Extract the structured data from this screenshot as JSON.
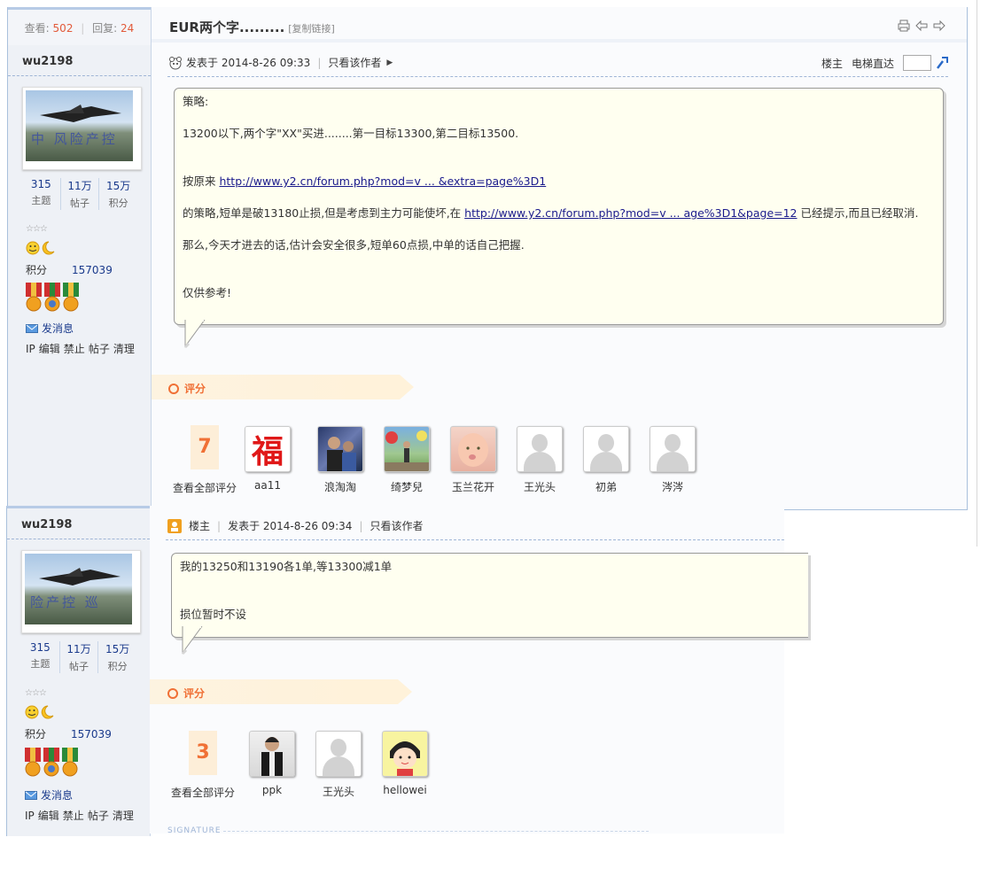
{
  "thread": {
    "views_label": "查看:",
    "views": "502",
    "replies_label": "回复:",
    "replies": "24",
    "title": "EUR两个字.........",
    "copy_link": "[复制链接]"
  },
  "floor_tools": {
    "owner_label": "楼主",
    "elevator_label": "电梯直达"
  },
  "posts": [
    {
      "author": "wu2198",
      "avatar_text": "中 风险产控",
      "counts": [
        {
          "value": "315",
          "label": "主题"
        },
        {
          "value": "11万",
          "label": "帖子"
        },
        {
          "value": "15万",
          "label": "积分"
        }
      ],
      "stars": "☆☆☆",
      "score_label": "积分",
      "score": "157039",
      "send_msg": "发消息",
      "admin_tools": [
        "IP",
        "编辑",
        "禁止",
        "帖子",
        "清理"
      ],
      "posted": "发表于 2014-8-26 09:33",
      "only_author": "只看该作者",
      "content": {
        "l1": "策略:",
        "l2": "13200以下,两个字\"XX\"买进........第一目标13300,第二目标13500.",
        "l3_prefix": "按原来 ",
        "l3_link": "http://www.y2.cn/forum.php?mod=v ... &extra=page%3D1",
        "l4_prefix": "的策略,短单是破13180止损,但是考虑到主力可能使坏,在 ",
        "l4_link": "http://www.y2.cn/forum.php?mod=v ... age%3D1&page=12",
        "l4_suffix": "   已经提示,而且已经取消.",
        "l5": "那么,今天才进去的话,估计会安全很多,短单60点损,中单的话自己把握.",
        "l6": "仅供参考!"
      },
      "rating_label": "评分",
      "rating_count": "7",
      "view_all_ratings": "查看全部评分",
      "raters": [
        "aa11",
        "浪淘淘",
        "绮梦兒",
        "玉兰花开",
        "王光头",
        "初弟",
        "涔涔"
      ]
    },
    {
      "author": "wu2198",
      "avatar_text": "险产控 巡",
      "counts": [
        {
          "value": "315",
          "label": "主题"
        },
        {
          "value": "11万",
          "label": "帖子"
        },
        {
          "value": "15万",
          "label": "积分"
        }
      ],
      "stars": "☆☆☆",
      "score_label": "积分",
      "score": "157039",
      "send_msg": "发消息",
      "admin_tools": [
        "IP",
        "编辑",
        "禁止",
        "帖子",
        "清理"
      ],
      "floor": "楼主",
      "posted": "发表于 2014-8-26 09:34",
      "only_author": "只看该作者",
      "content": {
        "l1": "我的13250和13190各1单,等13300减1单",
        "l2": "损位暂时不设"
      },
      "rating_label": "评分",
      "rating_count": "3",
      "view_all_ratings": "查看全部评分",
      "raters": [
        "ppk",
        "王光头",
        "hellowei"
      ],
      "signature_label": "SIGNATURE"
    }
  ],
  "colors": {
    "accent_orange": "#f07035",
    "link_blue": "#1a1a8c",
    "border_blue": "#a9c0dc",
    "bubble_bg": "#fffff0"
  }
}
